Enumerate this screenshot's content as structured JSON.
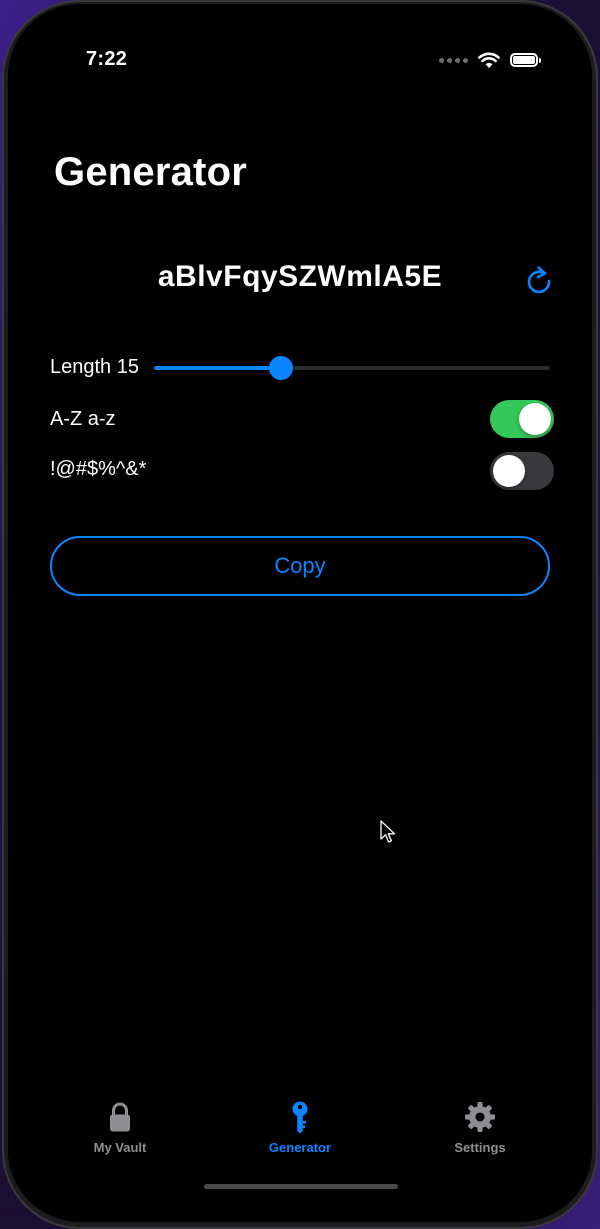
{
  "status_bar": {
    "time": "7:22",
    "battery_level": 1.0
  },
  "page": {
    "title": "Generator"
  },
  "generator": {
    "password": "aBlvFqySZWmlA5E",
    "length_label": "Length 15",
    "length_value": 15,
    "length_fraction": 0.32,
    "letters_label": "A-Z a-z",
    "letters_enabled": true,
    "symbols_label": "!@#$%^&*",
    "symbols_enabled": false,
    "copy_label": "Copy"
  },
  "tab_bar": {
    "tabs": [
      {
        "label": "My Vault",
        "icon": "lock-icon",
        "active": false
      },
      {
        "label": "Generator",
        "icon": "key-icon",
        "active": true
      },
      {
        "label": "Settings",
        "icon": "gear-icon",
        "active": false
      }
    ]
  },
  "colors": {
    "accent": "#0a84ff",
    "toggle_on": "#34c759",
    "toggle_off": "#39393d",
    "inactive_tab": "#8e8e93",
    "background": "#000000"
  }
}
